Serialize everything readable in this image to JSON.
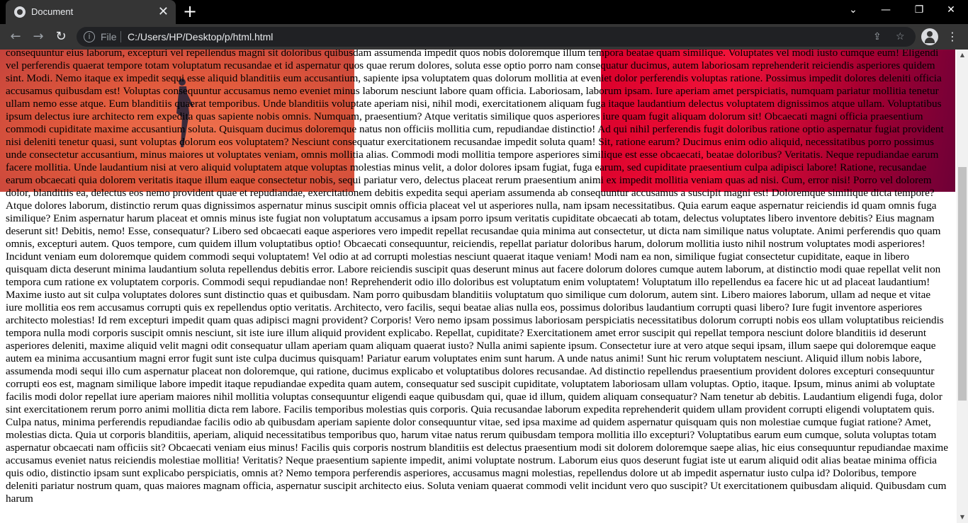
{
  "tab": {
    "title": "Document",
    "close": "✕"
  },
  "new_tab_label": "+",
  "window": {
    "minimize": "—",
    "restore": "❐",
    "close": "✕",
    "tab_search": "⌄"
  },
  "nav": {
    "back": "←",
    "forward": "→",
    "reload": "↻"
  },
  "omnibox": {
    "info": "i",
    "protocol": "File",
    "url": "C:/Users/HP/Desktop/p/html.html"
  },
  "icons": {
    "share": "⇪",
    "bookmark": "☆",
    "menu": "⋮"
  },
  "page": {
    "body_text": "consequuntur eius laborum, excepturi vel repellendus magni sit doloribus quibusdam assumenda impedit quos nobis doloremque illum tempora beatae quam similique. Voluptates vel modi iusto cumque eum! Eligendi vel perferendis quaerat tempore totam voluptatum recusandae et id aspernatur quos quae rerum dolores, soluta esse optio porro nam consequatur ducimus, autem laboriosam reprehenderit reiciendis asperiores quidem sint. Modi. Nemo itaque ex impedit sequi esse aliquid blanditiis eum accusantium, sapiente ipsa voluptatem quas dolorum mollitia at eveniet dolor perferendis voluptas ratione. Possimus impedit dolores deleniti officia accusamus quibusdam est! Voluptas consequuntur accusamus nemo eveniet minus laborum nesciunt labore quam officia. Laboriosam, laborum ipsam. Iure aperiam amet perspiciatis, numquam pariatur mollitia tenetur ullam nemo esse atque. Eum blanditiis quaerat temporibus. Unde blanditiis voluptate aperiam nisi, nihil modi, exercitationem aliquam fuga itaque laudantium delectus voluptatem dignissimos atque ullam. Voluptatibus ipsum delectus iure architecto rem expedita quas sapiente nobis omnis. Numquam, praesentium? Atque veritatis similique quos asperiores iure quam fugit aliquam dolorum sit! Obcaecati magni officia praesentium commodi cupiditate maxime accusantium soluta. Quisquam ducimus doloremque natus non officiis mollitia cum, repudiandae distinctio! Ad qui nihil perferendis fugit doloribus ratione optio aspernatur fugiat provident nisi deleniti tenetur quasi, sunt voluptas dolorum eos voluptatem? Nesciunt consequatur exercitationem recusandae impedit soluta quam! Sit, ratione earum? Ducimus enim odio aliquid, necessitatibus porro possimus unde consectetur accusantium, minus maiores ut voluptates veniam, omnis mollitia alias. Commodi modi mollitia tempore asperiores similique est esse obcaecati, beatae doloribus? Veritatis. Neque repudiandae earum facere mollitia. Unde laudantium nisi at vero aliquid voluptatem atque voluptas molestias minus velit, a dolor dolores ipsam fugiat, fuga earum, sed cupiditate praesentium culpa adipisci labore! Ratione, recusandae earum obcaecati quia dolorem veritatis itaque illum eaque consectetur nobis, sequi pariatur vero, delectus placeat rerum praesentium animi ex impedit mollitia veniam quas ad nisi. Cum, error nisi! Porro vel dolorem dolor, blanditiis ea, delectus eos nemo provident quae et repudiandae, exercitationem debitis expedita sequi aperiam assumenda ab consequuntur accusamus a suscipit magni est! Doloremque similique dicta tempore? Atque dolores laborum, distinctio rerum quas dignissimos aspernatur minus suscipit omnis officia placeat vel ut asperiores nulla, nam ipsam necessitatibus. Quia earum eaque aspernatur reiciendis id quam omnis fuga similique? Enim aspernatur harum placeat et omnis minus iste fugiat non voluptatum accusamus a ipsam porro ipsum veritatis cupiditate obcaecati ab totam, delectus voluptates libero inventore debitis? Eius magnam deserunt sit! Debitis, nemo! Esse, consequatur? Libero sed obcaecati eaque asperiores vero impedit repellat recusandae quia minima aut consectetur, ut dicta nam similique natus voluptate. Animi perferendis quo quam omnis, excepturi autem. Quos tempore, cum quidem illum voluptatibus optio! Obcaecati consequuntur, reiciendis, repellat pariatur doloribus harum, dolorum mollitia iusto nihil nostrum voluptates modi asperiores! Incidunt veniam eum doloremque quidem commodi sequi voluptatem! Vel odio at ad corrupti molestias nesciunt quaerat itaque veniam! Modi nam ea non, similique fugiat consectetur cupiditate, eaque in libero quisquam dicta deserunt minima laudantium soluta repellendus debitis error. Labore reiciendis suscipit quas deserunt minus aut facere dolorum dolores cumque autem laborum, at distinctio modi quae repellat velit non tempora cum ratione ex voluptatem corporis. Commodi sequi repudiandae non! Reprehenderit odio illo doloribus est voluptatum enim voluptatem! Voluptatum illo repellendus ea facere hic ut ad placeat laudantium! Maxime iusto aut sit culpa voluptates dolores sunt distinctio quas et quibusdam. Nam porro quibusdam blanditiis voluptatum quo similique cum dolorum, autem sint. Libero maiores laborum, ullam ad neque et vitae iure mollitia eos rem accusamus corrupti quis ex repellendus optio veritatis. Architecto, vero facilis, sequi beatae alias nulla eos, possimus doloribus laudantium corrupti quasi libero? Iure fugit inventore asperiores architecto molestias! Id rem excepturi impedit quam quas adipisci magni provident? Corporis! Vero nemo ipsam possimus laboriosam perspiciatis necessitatibus dolorum corrupti nobis eos ullam voluptatibus reiciendis tempora nulla modi corporis suscipit omnis nesciunt, sit iste iure illum aliquid provident explicabo. Repellat, cupiditate? Exercitationem amet error suscipit qui repellat tempora nesciunt dolore blanditiis id deserunt asperiores deleniti, maxime aliquid velit magni odit consequatur ullam aperiam quam aliquam quaerat iusto? Nulla animi sapiente ipsum. Consectetur iure at vero atque sequi ipsam, illum saepe qui doloremque eaque autem ea minima accusantium magni error fugit sunt iste culpa ducimus quisquam! Pariatur earum voluptates enim sunt harum. A unde natus animi! Sunt hic rerum voluptatem nesciunt. Aliquid illum nobis labore, assumenda modi sequi illo cum aspernatur placeat non doloremque, qui ratione, ducimus explicabo et voluptatibus dolores recusandae. Ad distinctio repellendus praesentium provident dolores excepturi consequuntur corrupti eos est, magnam similique labore impedit itaque repudiandae expedita quam autem, consequatur sed suscipit cupiditate, voluptatem laboriosam ullam voluptas. Optio, itaque. Ipsum, minus animi ab voluptate facilis modi dolor repellat iure aperiam maiores nihil mollitia voluptas consequuntur eligendi eaque quibusdam qui, quae id illum, quidem aliquam consequatur? Nam tenetur ab debitis. Laudantium eligendi fuga, dolor sint exercitationem rerum porro animi mollitia dicta rem labore. Facilis temporibus molestias quis corporis. Quia recusandae laborum expedita reprehenderit quidem ullam provident corrupti eligendi voluptatem quis. Culpa natus, minima perferendis repudiandae facilis odio ab quibusdam aperiam sapiente dolor consequuntur vitae, sed ipsa maxime ad quidem aspernatur quisquam quis non molestiae cumque fugiat ratione? Amet, molestias dicta. Quia ut corporis blanditiis, aperiam, aliquid necessitatibus temporibus quo, harum vitae natus rerum quibusdam tempora mollitia illo excepturi? Voluptatibus earum eum cumque, soluta voluptas totam aspernatur obcaecati nam officiis sit? Obcaecati veniam eius minus! Facilis quis corporis nostrum blanditiis est delectus praesentium modi sit dolorem doloremque saepe alias, hic eius consequuntur repudiandae maxime accusamus eveniet natus reiciendis molestiae mollitia! Veritatis? Neque praesentium sapiente impedit, animi voluptate nostrum. Laborum eius quos deserunt fugiat iste ut earum aliquid odit alias beatae minima officia quis odio, distinctio ipsam sunt explicabo perspiciatis, omnis at? Nemo tempora perferendis asperiores, accusamus magni molestias, repellendus dolore ut ab impedit aspernatur iusto culpa id? Doloribus, tempore deleniti pariatur nostrum quam, quas maiores magnam officia, aspernatur suscipit architecto eius. Soluta veniam quaerat commodi velit incidunt vero quo suscipit? Ut exercitationem quibusdam aliquid. Quibusdam cum harum"
  },
  "colors": {
    "chrome_bg": "#000000",
    "toolbar_bg": "#353535",
    "omnibox_bg": "#202124",
    "image_left": "#e15a3d",
    "image_right": "#d9002b"
  }
}
